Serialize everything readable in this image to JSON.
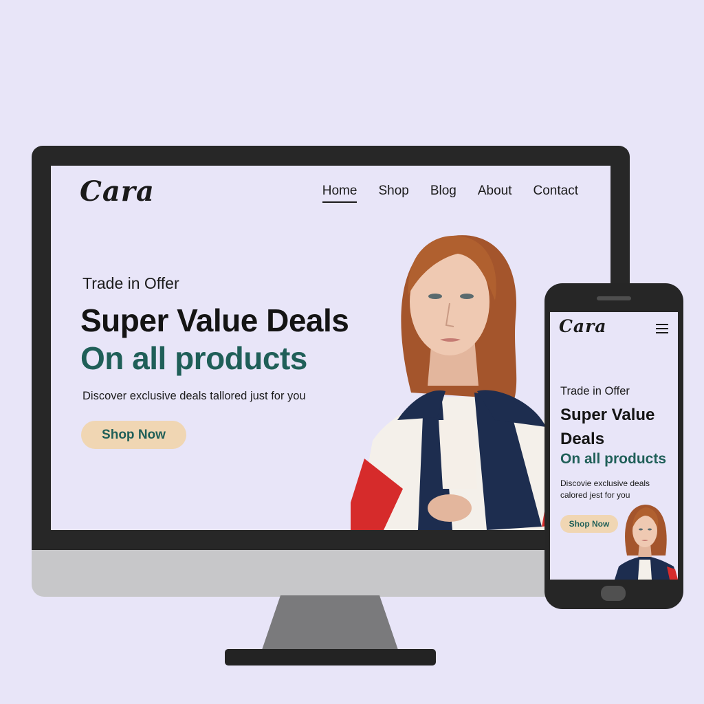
{
  "colors": {
    "background": "#e8e5f8",
    "accent_green": "#1f5f58",
    "button_peach": "#f0d6b3",
    "device_dark": "#262626"
  },
  "desktop": {
    "brand": "Cara",
    "nav": {
      "items": [
        {
          "label": "Home",
          "active": true
        },
        {
          "label": "Shop",
          "active": false
        },
        {
          "label": "Blog",
          "active": false
        },
        {
          "label": "About",
          "active": false
        },
        {
          "label": "Contact",
          "active": false
        }
      ]
    },
    "hero": {
      "kicker": "Trade in Offer",
      "headline": "Super Value Deals",
      "subheadline": "On all products",
      "description": "Discover exclusive deals tallored just for you",
      "cta_label": "Shop Now",
      "image": "model-photo"
    }
  },
  "mobile": {
    "brand": "Cara",
    "menu_icon": "hamburger-menu-icon",
    "hero": {
      "kicker": "Trade in Offer",
      "headline": "Super Value Deals",
      "subheadline": "On all products",
      "description": "Discovie exclusive deals calored jest for you",
      "cta_label": "Shop Now",
      "image": "model-photo"
    }
  }
}
